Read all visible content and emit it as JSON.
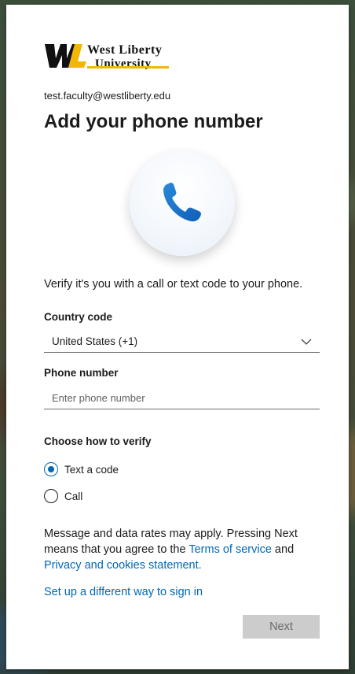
{
  "brand": {
    "logo_mark": "WL",
    "name_line1": "West Liberty",
    "name_line2": "University",
    "accent_color": "#f2b705"
  },
  "account": {
    "email": "test.faculty@westliberty.edu"
  },
  "page": {
    "title": "Add your phone number",
    "description": "Verify it's you with a call or text code to your phone."
  },
  "icons": {
    "hero": "phone-icon",
    "dropdown": "chevron-down-icon"
  },
  "form": {
    "country_code_label": "Country code",
    "country_code_value": "United States (+1)",
    "phone_label": "Phone number",
    "phone_placeholder": "Enter phone number",
    "verify_label": "Choose how to verify",
    "options": [
      {
        "label": "Text a code",
        "selected": true
      },
      {
        "label": "Call",
        "selected": false
      }
    ]
  },
  "notice": {
    "text_before": "Message and data rates may apply. Pressing Next means that you agree to the ",
    "terms_link": "Terms of service",
    "text_middle": " and ",
    "privacy_link": "Privacy and cookies statement."
  },
  "alt_signin_link": "Set up a different way to sign in",
  "buttons": {
    "next": "Next"
  },
  "colors": {
    "link": "#0067b8",
    "disabled_button": "#cccccc"
  }
}
